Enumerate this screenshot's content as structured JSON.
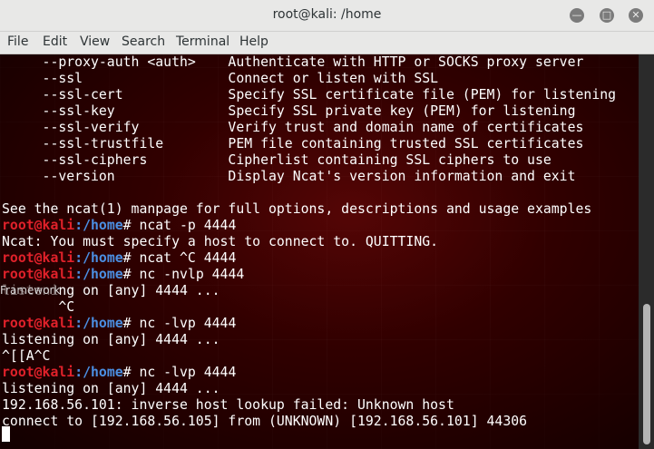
{
  "window": {
    "title": "root@kali: /home"
  },
  "menu": [
    "File",
    "Edit",
    "View",
    "Search",
    "Terminal",
    "Help"
  ],
  "terminal": {
    "lines": [
      {
        "type": "text",
        "text": "     --proxy-auth <auth>    Authenticate with HTTP or SOCKS proxy server"
      },
      {
        "type": "text",
        "text": "     --ssl                  Connect or listen with SSL"
      },
      {
        "type": "text",
        "text": "     --ssl-cert             Specify SSL certificate file (PEM) for listening"
      },
      {
        "type": "text",
        "text": "     --ssl-key              Specify SSL private key (PEM) for listening"
      },
      {
        "type": "text",
        "text": "     --ssl-verify           Verify trust and domain name of certificates"
      },
      {
        "type": "text",
        "text": "     --ssl-trustfile        PEM file containing trusted SSL certificates"
      },
      {
        "type": "text",
        "text": "     --ssl-ciphers          Cipherlist containing SSL ciphers to use"
      },
      {
        "type": "text",
        "text": "     --version              Display Ncat's version information and exit"
      },
      {
        "type": "text",
        "text": ""
      },
      {
        "type": "text",
        "text": "See the ncat(1) manpage for full options, descriptions and usage examples"
      },
      {
        "type": "prompt",
        "user": "root@kali",
        "path": ":/home",
        "cmd": "# ncat -p 4444"
      },
      {
        "type": "text",
        "text": "Ncat: You must specify a host to connect to. QUITTING."
      },
      {
        "type": "prompt",
        "user": "root@kali",
        "path": ":/home",
        "cmd": "# ncat ^C 4444"
      },
      {
        "type": "prompt",
        "user": "root@kali",
        "path": ":/home",
        "cmd": "# nc -nvlp 4444"
      },
      {
        "type": "text",
        "text": "listening on [any] 4444 ..."
      },
      {
        "type": "text",
        "text": "       ^C"
      },
      {
        "type": "prompt",
        "user": "root@kali",
        "path": ":/home",
        "cmd": "# nc -lvp 4444"
      },
      {
        "type": "text",
        "text": "listening on [any] 4444 ..."
      },
      {
        "type": "text",
        "text": "^[[A^C"
      },
      {
        "type": "prompt",
        "user": "root@kali",
        "path": ":/home",
        "cmd": "# nc -lvp 4444"
      },
      {
        "type": "text",
        "text": "listening on [any] 4444 ..."
      },
      {
        "type": "text",
        "text": "192.168.56.101: inverse host lookup failed: Unknown host"
      },
      {
        "type": "text",
        "text": "connect to [192.168.56.105] from (UNKNOWN) [192.168.56.101] 44306"
      }
    ],
    "overlay_text": "Framework"
  },
  "colors": {
    "prompt_user": "#e0212a",
    "prompt_path": "#4b8fe3",
    "text": "#ffffff"
  }
}
